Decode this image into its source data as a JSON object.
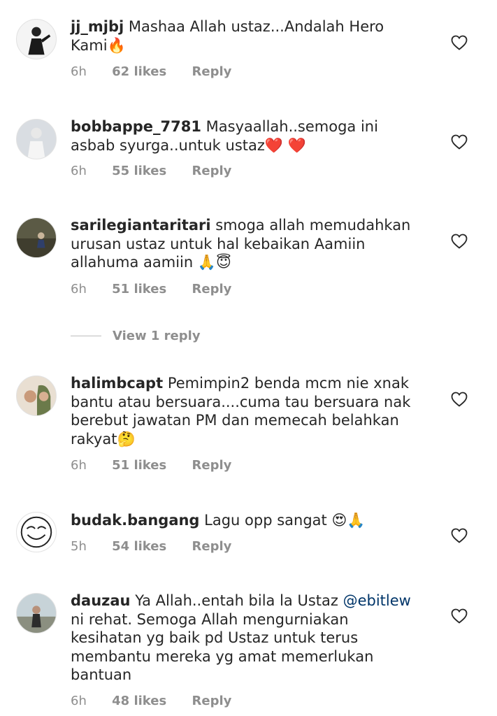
{
  "comments": [
    {
      "username": "jj_mjbj",
      "text": "Mashaa Allah ustaz...Andalah Hero Kami",
      "emoji": "🔥",
      "time": "6h",
      "likes": "62 likes",
      "reply": "Reply"
    },
    {
      "username": "bobbappe_7781",
      "text": "Masyaallah..semoga ini asbab syurga..untuk ustaz",
      "emoji": "❤️ ❤️",
      "time": "6h",
      "likes": "55 likes",
      "reply": "Reply"
    },
    {
      "username": "sarilegiantaritari",
      "text": "smoga allah memudahkan urusan ustaz  untuk hal kebaikan Aamiin allahuma aamiin",
      "emoji": "🙏😇",
      "time": "6h",
      "likes": "51 likes",
      "reply": "Reply",
      "view_replies": "View 1 reply"
    },
    {
      "username": "halimbcapt",
      "text": "Pemimpin2 benda mcm nie xnak bantu atau bersuara....cuma tau bersuara nak berebut jawatan PM dan memecah belahkan rakyat",
      "emoji": "🤔",
      "time": "6h",
      "likes": "51 likes",
      "reply": "Reply"
    },
    {
      "username": "budak.bangang",
      "text": "Lagu opp sangat",
      "emoji": "😍🙏",
      "time": "5h",
      "likes": "54 likes",
      "reply": "Reply"
    },
    {
      "username": "dauzau",
      "text_before": "Ya Allah..entah bila la Ustaz",
      "mention": "@ebitlew",
      "text_after": "ni rehat. Semoga Allah  mengurniakan kesihatan yg baik pd Ustaz untuk terus membantu mereka yg amat memerlukan bantuan",
      "time": "6h",
      "likes": "48 likes",
      "reply": "Reply"
    }
  ],
  "icons": {
    "heart": "heart-outline-icon"
  },
  "colors": {
    "text": "#262626",
    "secondary": "#8e8e8e",
    "mention": "#003569"
  }
}
